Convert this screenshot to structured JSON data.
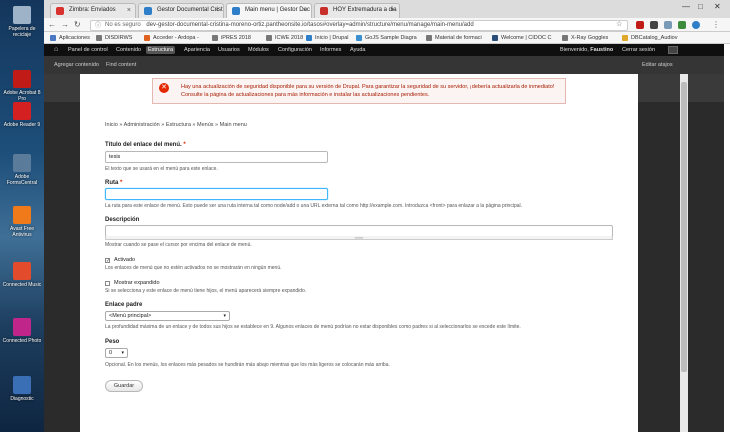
{
  "desktop": {
    "icons": [
      {
        "label": "Papelera de reciclaje",
        "color": "#9fb3c8"
      },
      {
        "label": "Adobe Acrobat 8 Pro",
        "color": "#c11b17"
      },
      {
        "label": "Adobe Reader 9",
        "color": "#d42020"
      },
      {
        "label": "Adobe FormsCentral",
        "color": "#5b7b9a"
      },
      {
        "label": "Avast Free Antivirus",
        "color": "#f07a1a"
      },
      {
        "label": "Connected Music",
        "color": "#e24b2b"
      },
      {
        "label": "Connected Photo",
        "color": "#c0268a"
      },
      {
        "label": "Diagnostic",
        "color": "#3a6fb5"
      }
    ]
  },
  "browser": {
    "tabs": [
      {
        "title": "Zimbra: Enviados",
        "color": "#d9322e",
        "active": false
      },
      {
        "title": "Gestor Documental Cristi",
        "color": "#2d7fc9",
        "active": false
      },
      {
        "title": "Main menu | Gestor Doc",
        "color": "#2d7fc9",
        "active": true
      },
      {
        "title": "HOY Extremadura a dia",
        "color": "#c9302c",
        "active": false
      }
    ],
    "window_controls": [
      "—",
      "□",
      "✕"
    ],
    "address": {
      "security": "No es seguro",
      "url": "dev-gestor-documental-cristina-moreno-ortiz.pantheonsite.io/tasos#overlay=admin/structure/menu/manage/main-menu/add"
    },
    "bookmarks": [
      {
        "label": "Aplicaciones",
        "color": "#4a78c2"
      },
      {
        "label": "DISDIRWS",
        "color": "#777777"
      },
      {
        "label": "Acceder - Ardopa -",
        "color": "#e0621f"
      },
      {
        "label": "iPRES 2018",
        "color": "#777777"
      },
      {
        "label": "ICWE 2018",
        "color": "#777777"
      },
      {
        "label": "Inicio | Drupal",
        "color": "#2d7fc9"
      },
      {
        "label": "GoJS Sample Diagra",
        "color": "#3a8fd1"
      },
      {
        "label": "Material de formaci",
        "color": "#777777"
      },
      {
        "label": "Welcome | CIDOC C",
        "color": "#2a4d7a"
      },
      {
        "label": "X-Ray Goggles",
        "color": "#777777"
      },
      {
        "label": "DBCatalog_Audiov",
        "color": "#e0a82a"
      }
    ]
  },
  "toolbar": {
    "items": [
      "Panel de control",
      "Contenido",
      "Estructura",
      "Apariencia",
      "Usuarios",
      "Módulos",
      "Configuración",
      "Informes",
      "Ayuda"
    ],
    "active": "Estructura",
    "welcome_prefix": "Bienvenido,",
    "user": "Faustino",
    "logout": "Cerrar sesión",
    "tray_items": [
      "Agregar contenido",
      "Find content"
    ],
    "edit_shortcuts": "Editar atajos"
  },
  "alert": {
    "message": "Hay una actualización de seguridad disponible para su versión de Drupal. Para garantizar la seguridad de su servidor, ¡debería actualizarla de inmediato! Consulte la página de actualizaciones para más información e instalar las actualizaciones pendientes."
  },
  "breadcrumb": "Inicio » Administración » Estructura » Menús » Main menu",
  "form": {
    "title_label": "Título del enlace del menú.",
    "required_mark": "*",
    "title_value": "tesis",
    "title_help": "El texto que se usará en el menú para este enlace.",
    "path_label": "Ruta",
    "path_value": "",
    "path_help": "La ruta para este enlace de menú. Esto puede ser una ruta interna tal como node/add o una URL externa tal como http://example.com. Introduzca <front> para enlazar a la página principal.",
    "desc_label": "Descripción",
    "desc_value": "",
    "desc_help": "Mostrar cuando se pase el cursor por encima del enlace de menú.",
    "enabled_label": "Activado",
    "enabled_checked": true,
    "enabled_help": "Los enlaces de menú que no estén activados no se mostrarán en ningún menú.",
    "expanded_label": "Mostrar expandido",
    "expanded_checked": false,
    "expanded_help": "Si se selecciona y este enlace de menú tiene hijos, el menú aparecerá siempre expandido.",
    "parent_label": "Enlace padre",
    "parent_value": "<Menú principal>",
    "parent_help": "La profundidad máxima de un enlace y de todos sus hijos se establece en 9. Algunos enlaces de menú podrían no estar disponibles como padres si al seleccionarlos se excede este límite.",
    "weight_label": "Peso",
    "weight_value": "0",
    "weight_help": "Opcional. En los menús, los enlaces más pesados se hundirán más abajo mientras que los más ligeros se colocarán más arriba.",
    "save_label": "Guardar"
  }
}
